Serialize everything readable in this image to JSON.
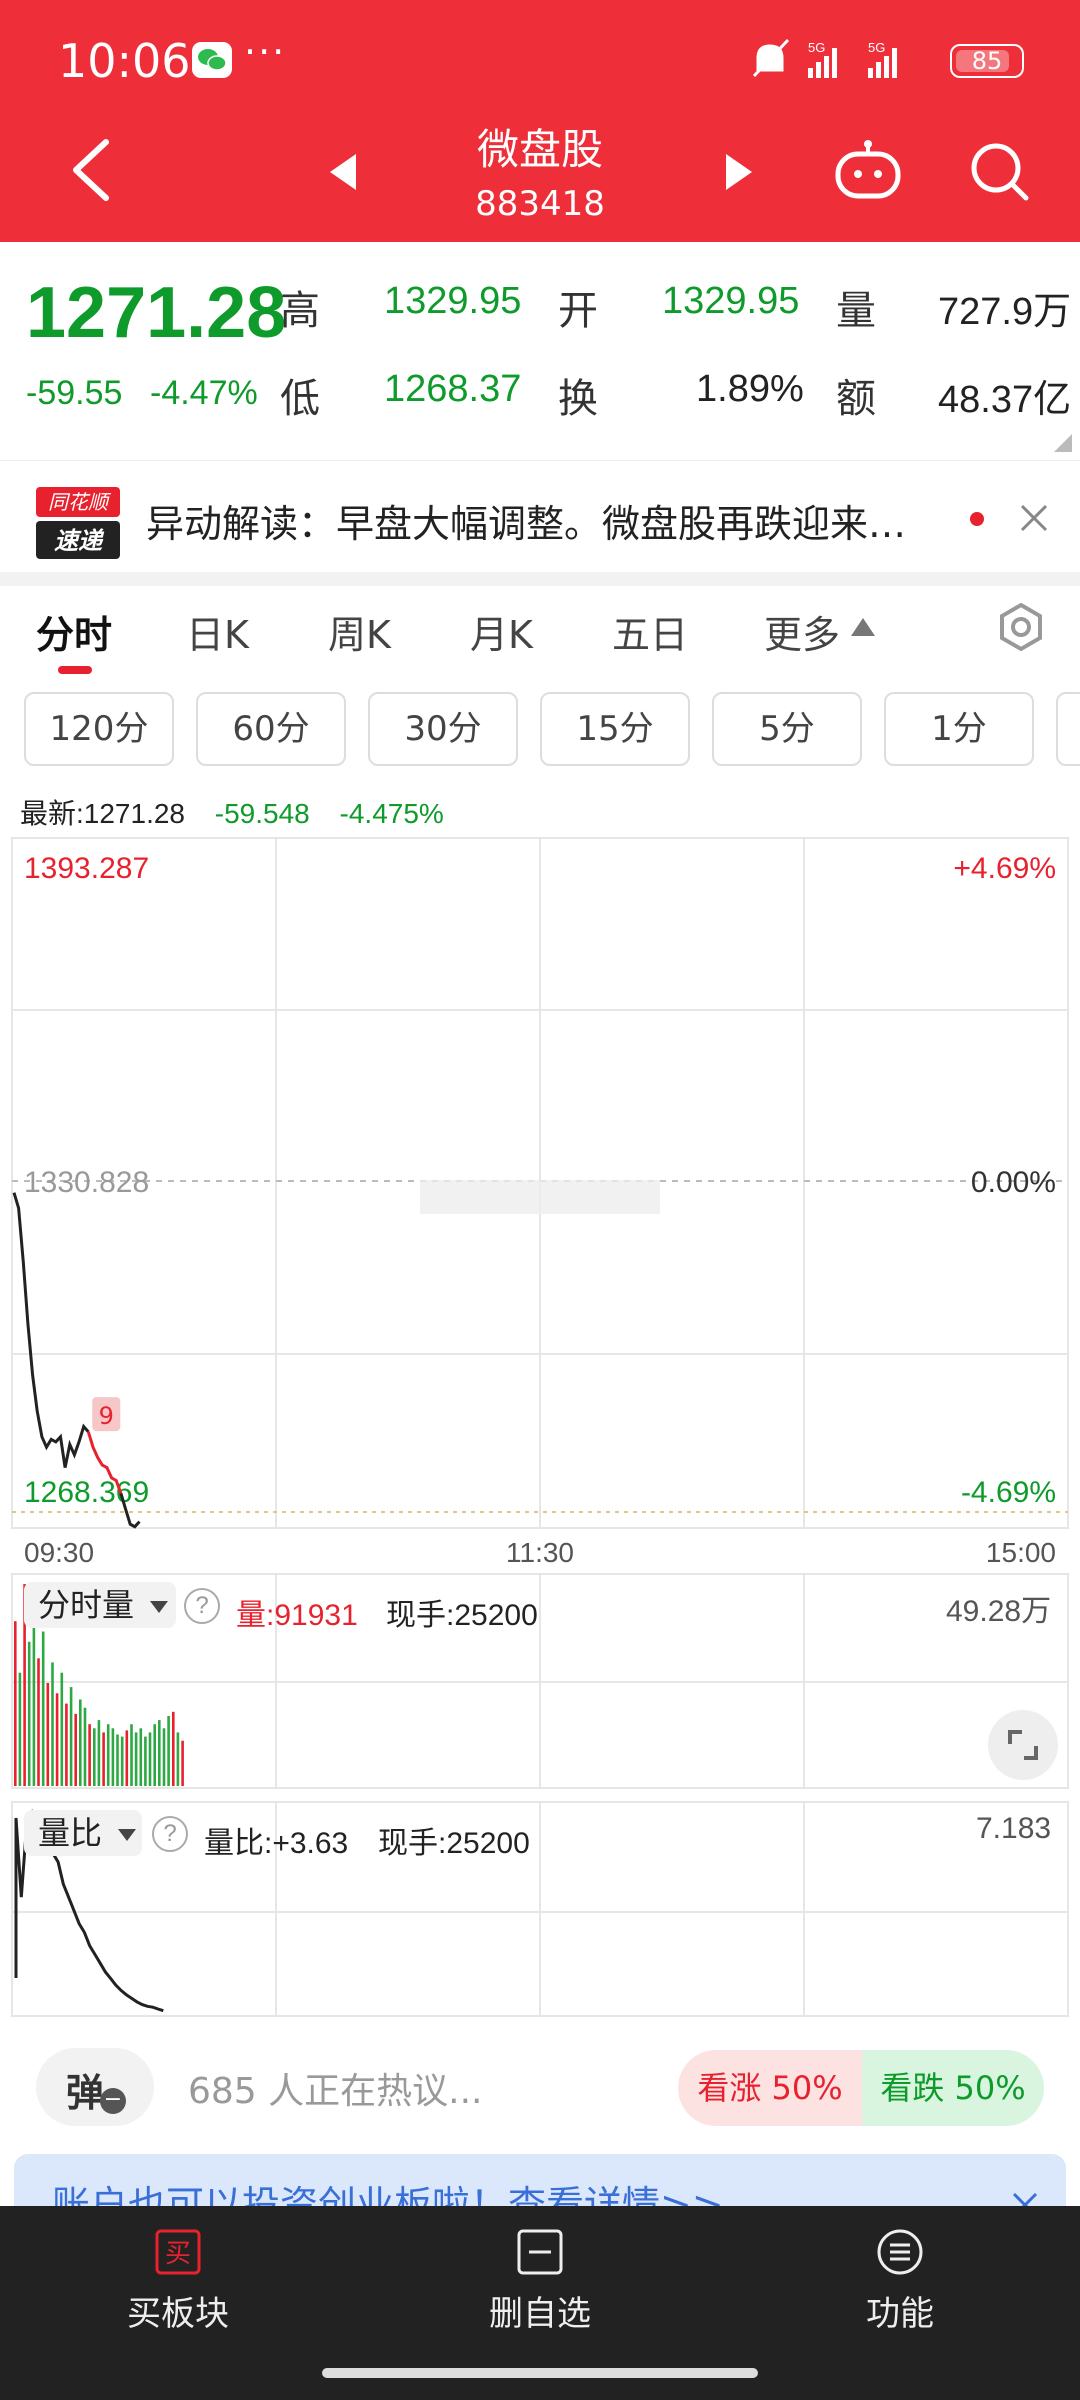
{
  "status_bar": {
    "time": "10:06",
    "more": "···",
    "signal": "5G 5G",
    "battery": "85",
    "battery_fraction": 0.85
  },
  "header": {
    "title": "微盘股",
    "code": "883418"
  },
  "quote": {
    "price": "1271.28",
    "change": "-59.55",
    "change_pct": "-4.47%",
    "high_label": "高",
    "high": "1329.95",
    "low_label": "低",
    "low": "1268.37",
    "open_label": "开",
    "open": "1329.95",
    "turnover_label": "换",
    "turnover": "1.89%",
    "volume_label": "量",
    "volume": "727.9万",
    "amount_label": "额",
    "amount": "48.37亿"
  },
  "news": {
    "logo_line1": "同花顺",
    "logo_line2": "速递",
    "text": "异动解读：早盘大幅调整。微盘股再跌迎来…"
  },
  "tabs": [
    "分时",
    "日K",
    "周K",
    "月K",
    "五日",
    "更多"
  ],
  "periods": [
    "120分",
    "60分",
    "30分",
    "15分",
    "5分",
    "1分"
  ],
  "latest": {
    "label": "最新:1271.28",
    "change": "-59.548",
    "pct": "-4.475%"
  },
  "chart_data": {
    "type": "line",
    "y_max": "1393.287",
    "y_mid": "1330.828",
    "y_min": "1268.369",
    "pct_max": "+4.69%",
    "pct_mid": "0.00%",
    "pct_min": "-4.69%",
    "ylim": [
      1268.369,
      1393.287
    ],
    "prev_close": 1330.828,
    "x_labels": [
      "09:30",
      "11:30",
      "15:00"
    ],
    "marker_label": "9",
    "series": [
      {
        "values": [
          1330.5,
          1327.5,
          1317.0,
          1305.0,
          1295.0,
          1288.0,
          1283.0,
          1281.0,
          1282.5,
          1282.0,
          1283.0,
          1277.0,
          1281.5,
          1279.5,
          1282.0,
          1285.0,
          1284.0,
          1281.0,
          1279.0,
          1277.5,
          1277.0,
          1275.0,
          1274.5,
          1272.0,
          1269.0,
          1266.0,
          1265.5,
          1266.5
        ]
      }
    ],
    "highlight_range": [
      16,
      23
    ],
    "volume": {
      "label": "分时量",
      "amount_label": "量:91931",
      "hand_label": "现手:25200",
      "max_label": "49.28万",
      "bars": [
        80,
        55,
        98,
        70,
        90,
        62,
        75,
        50,
        60,
        45,
        55,
        40,
        48,
        35,
        42,
        38,
        30,
        28,
        32,
        26,
        30,
        28,
        25,
        24,
        27,
        30,
        26,
        28,
        24,
        26,
        30,
        32,
        28,
        34,
        36,
        26,
        22
      ],
      "bar_colors": [
        "r",
        "g",
        "r",
        "g",
        "g",
        "r",
        "g",
        "r",
        "g",
        "r",
        "g",
        "r",
        "g",
        "r",
        "g",
        "g",
        "r",
        "g",
        "g",
        "r",
        "g",
        "g",
        "g",
        "g",
        "r",
        "g",
        "g",
        "g",
        "g",
        "g",
        "g",
        "g",
        "g",
        "g",
        "r",
        "g",
        "r"
      ]
    },
    "ratio": {
      "label": "量比",
      "ratio_label": "量比:+3.63",
      "hand_label": "现手:25200",
      "max_label": "7.183",
      "values": [
        7.0,
        5.2,
        6.8,
        7.1,
        6.6,
        6.4,
        6.5,
        6.2,
        6.0,
        5.5,
        5.2,
        4.9,
        4.6,
        4.4,
        4.1,
        3.9,
        3.7,
        3.5,
        3.35,
        3.2,
        3.08,
        2.98,
        2.9,
        2.82,
        2.76,
        2.72,
        2.7,
        2.66,
        2.62
      ]
    }
  },
  "discussion": {
    "comment_btn": "弹",
    "hot_text": "685 人正在热议...",
    "bull": "看涨 50%",
    "bear": "看跌 50%"
  },
  "banner": {
    "text": "账户也可以投资创业板啦！查看详情>>"
  },
  "bottom_bar": {
    "buy": "买板块",
    "buy_icon_text": "买",
    "remove": "删自选",
    "functions": "功能"
  },
  "colors": {
    "header_red": "#ee2f3a",
    "down_green": "#0f9b2c",
    "up_red": "#e8212e"
  }
}
